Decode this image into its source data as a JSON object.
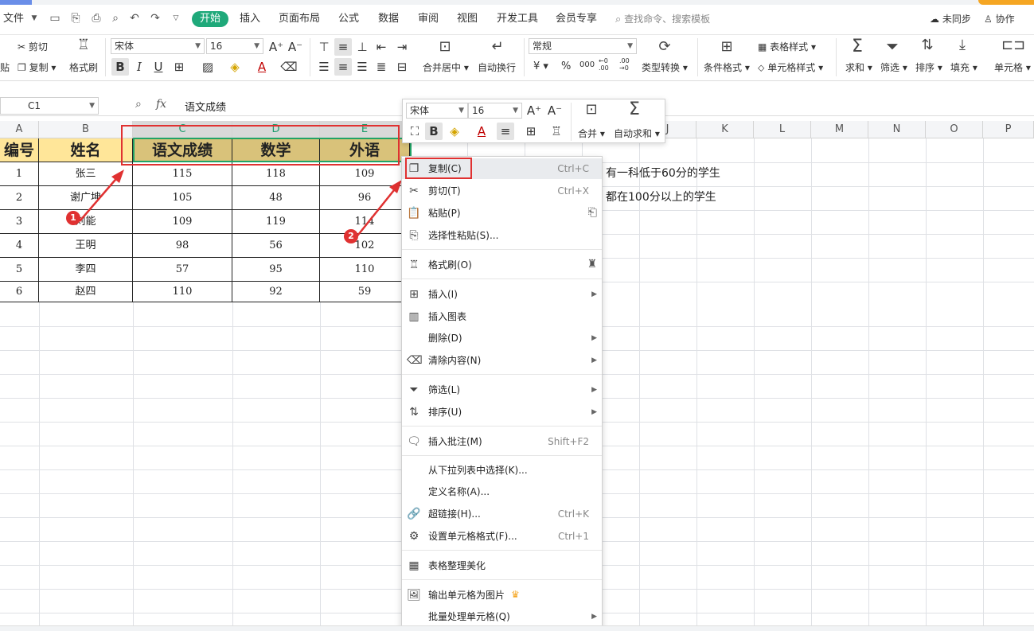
{
  "menubar": {
    "file": "文件",
    "tabs": [
      "开始",
      "插入",
      "页面布局",
      "公式",
      "数据",
      "审阅",
      "视图",
      "开发工具",
      "会员专享"
    ],
    "search_placeholder": "查找命令、搜索模板",
    "sync": "未同步",
    "collab": "协作"
  },
  "ribbon": {
    "cut": "剪切",
    "copy": "复制",
    "paste_partial": "贴",
    "format_painter": "格式刷",
    "font_name": "宋体",
    "font_size": "16",
    "merge_center": "合并居中",
    "auto_wrap": "自动换行",
    "number_format": "常规",
    "type_convert": "类型转换",
    "cond_format": "条件格式",
    "table_style": "表格样式",
    "cell_style": "单元格样式",
    "sum": "求和",
    "filter": "筛选",
    "sort": "排序",
    "fill": "填充",
    "cell": "单元格",
    "currency": "¥",
    "percent": "%",
    "thousands": "000",
    "dec_inc": "←0 .00",
    "dec_dec": ".00 →0"
  },
  "formula_bar": {
    "cell_ref": "C1",
    "fx": "fx",
    "value": "语文成绩"
  },
  "columns": [
    "A",
    "B",
    "C",
    "D",
    "E",
    "F",
    "G",
    "H",
    "I",
    "J",
    "K",
    "L",
    "M",
    "N",
    "O",
    "P"
  ],
  "table": {
    "headers": [
      "编号",
      "姓名",
      "语文成绩",
      "数学",
      "外语"
    ],
    "rows": [
      [
        "1",
        "张三",
        "115",
        "118",
        "109"
      ],
      [
        "2",
        "谢广坤",
        "105",
        "48",
        "96"
      ],
      [
        "3",
        "刘能",
        "109",
        "119",
        "114"
      ],
      [
        "4",
        "王明",
        "98",
        "56",
        "102"
      ],
      [
        "5",
        "李四",
        "57",
        "95",
        "110"
      ],
      [
        "6",
        "赵四",
        "110",
        "92",
        "59"
      ]
    ]
  },
  "notes": [
    "有一科低于60分的学生",
    "都在100分以上的学生"
  ],
  "badges": [
    "1",
    "2"
  ],
  "mini_toolbar": {
    "font_name": "宋体",
    "font_size": "16",
    "merge": "合并",
    "autosum": "自动求和"
  },
  "context_menu": {
    "copy": {
      "label": "复制(C)",
      "shortcut": "Ctrl+C"
    },
    "cut": {
      "label": "剪切(T)",
      "shortcut": "Ctrl+X"
    },
    "paste": {
      "label": "粘贴(P)"
    },
    "paste_special": {
      "label": "选择性粘贴(S)..."
    },
    "format_painter": {
      "label": "格式刷(O)"
    },
    "insert": {
      "label": "插入(I)"
    },
    "insert_chart": {
      "label": "插入图表"
    },
    "delete": {
      "label": "删除(D)"
    },
    "clear": {
      "label": "清除内容(N)"
    },
    "filter": {
      "label": "筛选(L)"
    },
    "sort": {
      "label": "排序(U)"
    },
    "comment": {
      "label": "插入批注(M)",
      "shortcut": "Shift+F2"
    },
    "dropdown": {
      "label": "从下拉列表中选择(K)..."
    },
    "define_name": {
      "label": "定义名称(A)..."
    },
    "hyperlink": {
      "label": "超链接(H)...",
      "shortcut": "Ctrl+K"
    },
    "cell_format": {
      "label": "设置单元格格式(F)...",
      "shortcut": "Ctrl+1"
    },
    "beautify": {
      "label": "表格整理美化"
    },
    "export_image": {
      "label": "输出单元格为图片"
    },
    "batch": {
      "label": "批量处理单元格(Q)"
    }
  },
  "colors": {
    "accent": "#1fa97a",
    "annotation": "#e03131",
    "header_yellow": "#ffe699",
    "header_tan": "#d9c27a"
  }
}
